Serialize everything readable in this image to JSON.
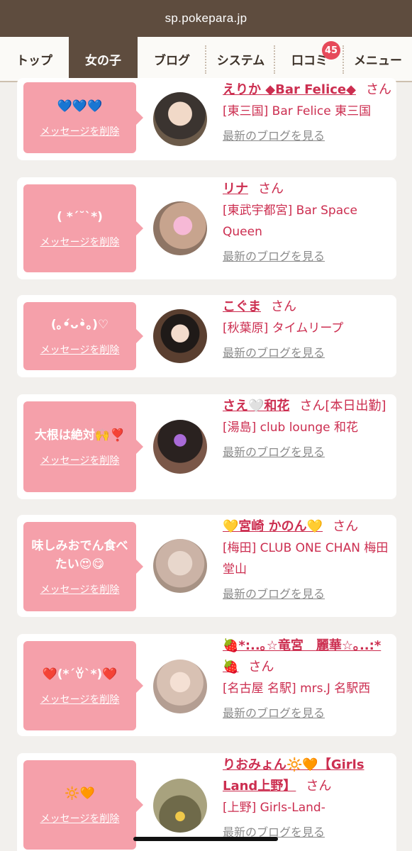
{
  "browser": {
    "url": "sp.pokepara.jp"
  },
  "nav": {
    "tabs": [
      {
        "label": "トップ"
      },
      {
        "label": "女の子"
      },
      {
        "label": "ブログ"
      },
      {
        "label": "システム"
      },
      {
        "label": "口コミ",
        "badge": "45"
      },
      {
        "label": "メニュー"
      }
    ]
  },
  "cards": [
    {
      "message": "💙💙💙",
      "delete_label": "メッセージを削除",
      "name": "えりか ◆Bar Felice◆",
      "suffix": "さん",
      "shop": "[東三国] Bar Felice 東三国",
      "blog_link": "最新のブログを見る"
    },
    {
      "message": "( *´˘`*)",
      "delete_label": "メッセージを削除",
      "name": "リナ",
      "suffix": "さん",
      "shop": "[東武宇都宮] Bar Space Queen",
      "blog_link": "最新のブログを見る"
    },
    {
      "message": "(｡•́ᴗ•̀｡)♡",
      "delete_label": "メッセージを削除",
      "name": "こぐま",
      "suffix": "さん",
      "shop": "[秋葉原] タイムリープ",
      "blog_link": "最新のブログを見る"
    },
    {
      "message": "大根は絶対🙌❣️",
      "delete_label": "メッセージを削除",
      "name": "さえ🤍和花",
      "suffix": "さん[本日出勤]",
      "shop": "[湯島] club lounge 和花",
      "blog_link": "最新のブログを見る"
    },
    {
      "message": "味しみおでん食べたい😍😋",
      "delete_label": "メッセージを削除",
      "name": "💛宮崎 かのん💛",
      "suffix": "さん",
      "shop": "[梅田] CLUB ONE CHAN 梅田堂山",
      "blog_link": "最新のブログを見る"
    },
    {
      "message": "❤️(*´ꈊ`*)❤️",
      "delete_label": "メッセージを削除",
      "name": "🍓*:..｡☆竜宮　麗華☆｡..:*🍓",
      "suffix": "さん",
      "shop": "[名古屋 名駅] mrs.J 名駅西",
      "blog_link": "最新のブログを見る"
    },
    {
      "message": "🔆🧡",
      "delete_label": "メッセージを削除",
      "name": "りおみょん🔆🧡【Girls Land上野】",
      "suffix": "さん",
      "shop": "[上野] Girls-Land-",
      "blog_link": "最新のブログを見る"
    }
  ]
}
